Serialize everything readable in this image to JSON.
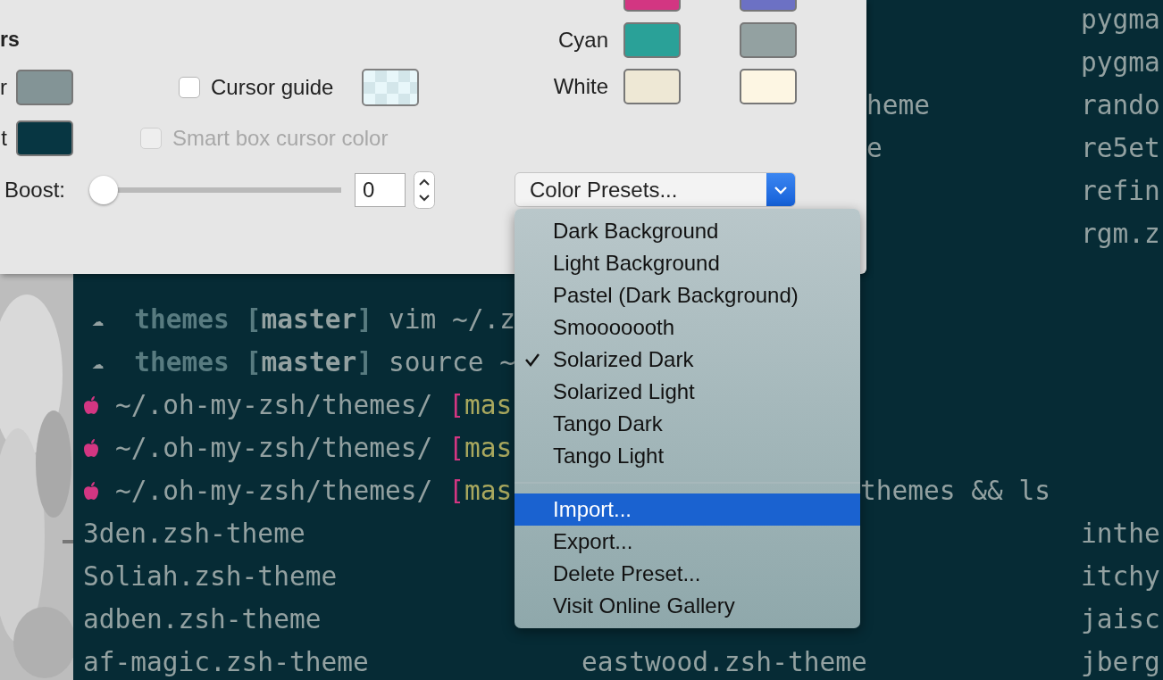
{
  "terminal": {
    "lines": [
      {
        "kind": "listing",
        "column_3": "pygma"
      },
      {
        "kind": "listing",
        "column_3": "pygma"
      },
      {
        "kind": "listing",
        "column_2": "heme",
        "column_3": "rando"
      },
      {
        "kind": "listing",
        "column_2": "e",
        "column_3": "re5et"
      },
      {
        "kind": "listing",
        "column_3": "refin"
      },
      {
        "kind": "listing",
        "column_3": "rgm.z"
      },
      {
        "kind": "cloud_prompt",
        "glyph": "☁",
        "dir": "themes",
        "branch": "[**master**]",
        "command": "vim ~/.z"
      },
      {
        "kind": "cloud_prompt",
        "glyph": "☁",
        "dir": "themes",
        "branch": "[**master**]",
        "command": "source ~"
      },
      {
        "kind": "fruit_prompt",
        "dir": "~/.oh-my-zsh/themes/",
        "bracket": "[",
        "branch": "mas"
      },
      {
        "kind": "fruit_prompt",
        "dir": "~/.oh-my-zsh/themes/",
        "bracket": "[",
        "branch": "mas"
      },
      {
        "kind": "fruit_prompt",
        "dir": "~/.oh-my-zsh/themes/",
        "bracket": "[",
        "branch": "mas",
        "tail": "themes && ls"
      },
      {
        "kind": "listing",
        "column_1": "3den.zsh-theme",
        "column_3": "inthe"
      },
      {
        "kind": "listing",
        "column_1": "Soliah.zsh-theme",
        "column_3": "itchy"
      },
      {
        "kind": "listing",
        "column_1": "adben.zsh-theme",
        "column_3": "jaisc"
      },
      {
        "kind": "listing",
        "column_1": "af-magic.zsh-theme",
        "column_2": "eastwood.zsh-theme",
        "column_3": "jberg"
      }
    ]
  },
  "panel": {
    "heading": "rs",
    "cursor_rows": [
      {
        "label": "r",
        "color": "#839496"
      },
      {
        "label": "t",
        "color": "#073642"
      }
    ],
    "checkboxes": [
      {
        "label": "Cursor guide",
        "checked": false,
        "disabled": false
      },
      {
        "label": "Smart box cursor color",
        "checked": false,
        "disabled": true
      }
    ],
    "boost": {
      "label": "Boost:",
      "level": 0,
      "value": "0"
    },
    "ansi_rows": [
      {
        "swatches": [
          {
            "color": "#d33682"
          },
          {
            "color": "#6c71c4"
          }
        ]
      },
      {
        "label": "Cyan",
        "swatches": [
          {
            "color": "#2aa198"
          },
          {
            "color": "#93a1a1"
          }
        ]
      },
      {
        "label": "White",
        "swatches": [
          {
            "color": "#eee8d5"
          },
          {
            "color": "#fdf6e3"
          }
        ]
      }
    ],
    "presets_button": "Color Presets..."
  },
  "menu": {
    "presets": [
      {
        "label": "Dark Background",
        "checked": false
      },
      {
        "label": "Light Background",
        "checked": false
      },
      {
        "label": "Pastel (Dark Background)",
        "checked": false
      },
      {
        "label": "Smooooooth",
        "checked": false
      },
      {
        "label": "Solarized Dark",
        "checked": true
      },
      {
        "label": "Solarized Light",
        "checked": false
      },
      {
        "label": "Tango Dark",
        "checked": false
      },
      {
        "label": "Tango Light",
        "checked": false
      }
    ],
    "actions": [
      {
        "label": "Import...",
        "selected": true
      },
      {
        "label": "Export...",
        "selected": false
      },
      {
        "label": "Delete Preset...",
        "selected": false
      },
      {
        "label": "Visit Online Gallery",
        "selected": false
      }
    ]
  }
}
